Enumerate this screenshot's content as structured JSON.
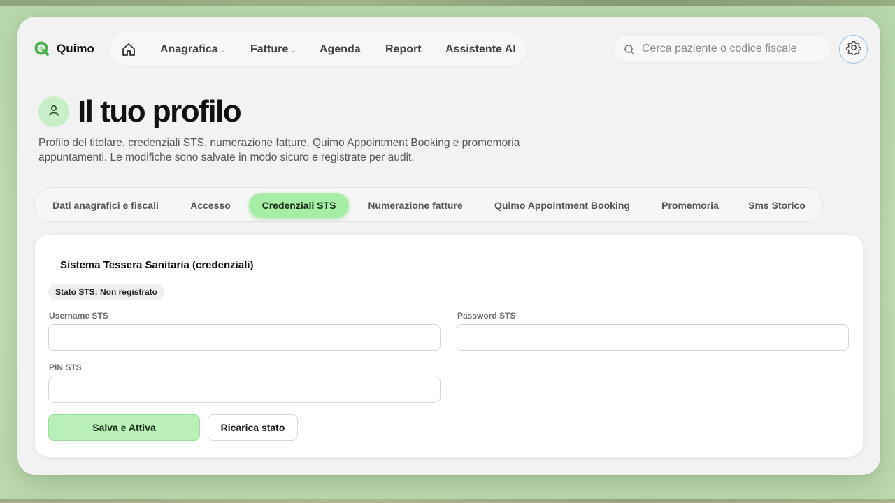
{
  "app": {
    "name": "Quimo",
    "logo_icon": "quimo-logo-icon",
    "accent": "#4caf50"
  },
  "nav": {
    "home_icon": "home-icon",
    "items": [
      {
        "label": "Anagrafica",
        "caret": "⌄"
      },
      {
        "label": "Fatture",
        "caret": "⌄"
      },
      {
        "label": "Agenda"
      },
      {
        "label": "Report"
      },
      {
        "label": "Assistente AI"
      }
    ]
  },
  "search": {
    "placeholder": "Cerca paziente o codice fiscale",
    "value": ""
  },
  "settings": {
    "icon": "gear-icon"
  },
  "header": {
    "title": "Il tuo profilo",
    "avatar_icon": "user-icon",
    "subtitle": "Profilo del titolare, credenziali STS, numerazione fatture, Quimo Appointment Booking e promemoria appuntamenti. Le modifiche sono salvate in modo sicuro e registrate per audit."
  },
  "tabs": [
    {
      "label": "Dati anagrafici e fiscali",
      "active": false
    },
    {
      "label": "Accesso",
      "active": false
    },
    {
      "label": "Credenziali STS",
      "active": true
    },
    {
      "label": "Numerazione fatture",
      "active": false
    },
    {
      "label": "Quimo Appointment Booking",
      "active": false
    },
    {
      "label": "Promemoria",
      "active": false
    },
    {
      "label": "Sms Storico",
      "active": false
    }
  ],
  "card": {
    "title": "Sistema Tessera Sanitaria (credenziali)",
    "status_badge": "Stato STS: Non registrato",
    "fields": {
      "username": {
        "label": "Username STS",
        "value": ""
      },
      "password": {
        "label": "Password STS",
        "value": ""
      },
      "pin": {
        "label": "PIN STS",
        "value": ""
      }
    },
    "buttons": {
      "primary": "Salva e Attiva",
      "secondary": "Ricarica stato"
    }
  }
}
